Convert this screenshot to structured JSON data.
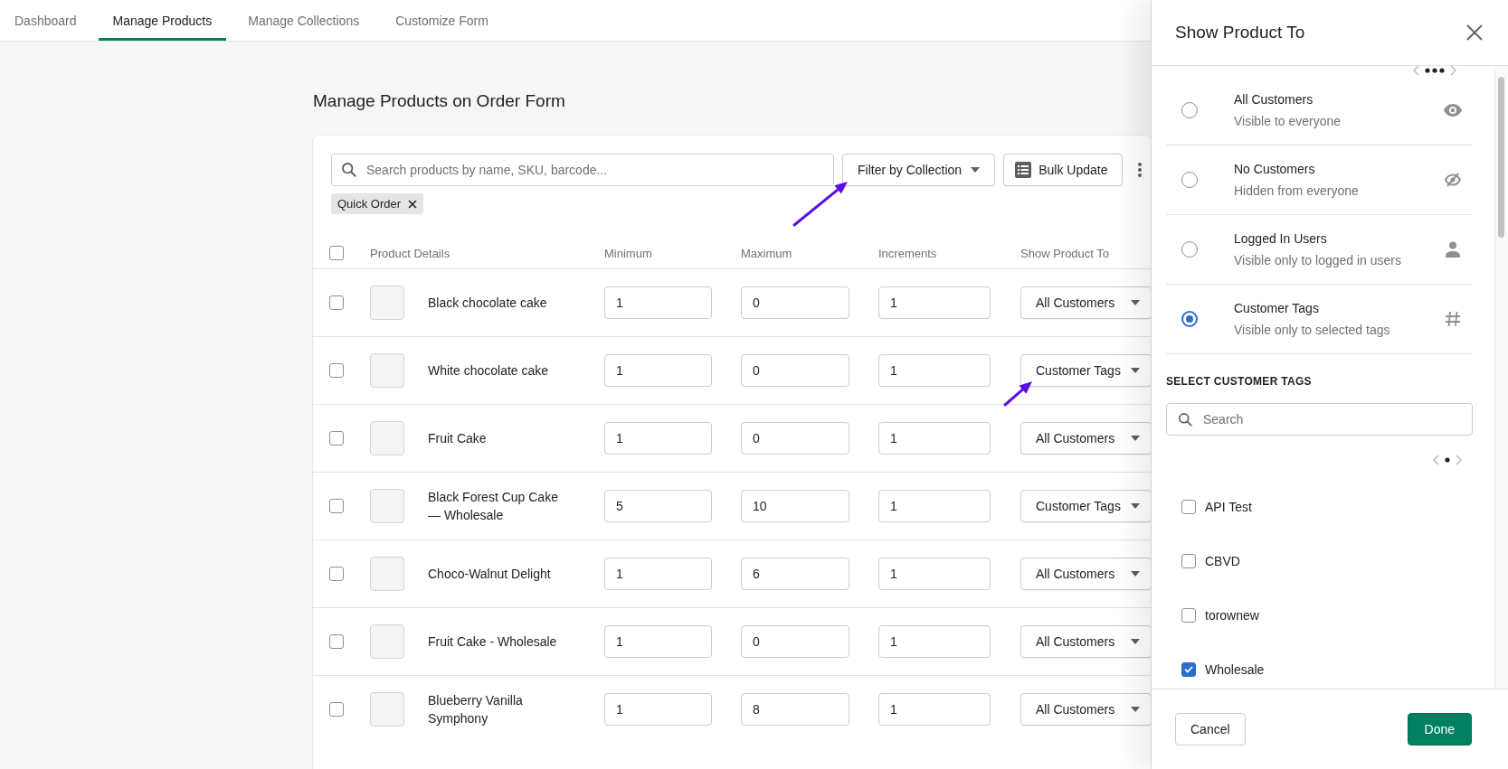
{
  "tabs": [
    {
      "label": "Dashboard",
      "selected": false
    },
    {
      "label": "Manage Products",
      "selected": true
    },
    {
      "label": "Manage Collections",
      "selected": false
    },
    {
      "label": "Customize Form",
      "selected": false
    }
  ],
  "page_title": "Manage Products on Order Form",
  "search": {
    "placeholder": "Search products by name, SKU, barcode..."
  },
  "filter_button": "Filter by Collection",
  "bulk_button": "Bulk Update",
  "filter_chips": [
    {
      "label": "Quick Order"
    }
  ],
  "table": {
    "select_all_checked": false,
    "columns": [
      "Product Details",
      "Minimum",
      "Maximum",
      "Increments",
      "Show Product To"
    ],
    "rows": [
      {
        "checked": false,
        "name": "Black chocolate cake",
        "minimum": "1",
        "maximum": "0",
        "increments": "1",
        "visibility": "All Customers"
      },
      {
        "checked": false,
        "name": "White chocolate cake",
        "minimum": "1",
        "maximum": "0",
        "increments": "1",
        "visibility": "Customer Tags"
      },
      {
        "checked": false,
        "name": "Fruit Cake",
        "minimum": "1",
        "maximum": "0",
        "increments": "1",
        "visibility": "All Customers"
      },
      {
        "checked": false,
        "name": "Black Forest Cup Cake — Wholesale",
        "minimum": "5",
        "maximum": "10",
        "increments": "1",
        "visibility": "Customer Tags"
      },
      {
        "checked": false,
        "name": "Choco-Walnut Delight",
        "minimum": "1",
        "maximum": "6",
        "increments": "1",
        "visibility": "All Customers"
      },
      {
        "checked": false,
        "name": "Fruit Cake - Wholesale",
        "minimum": "1",
        "maximum": "0",
        "increments": "1",
        "visibility": "All Customers"
      },
      {
        "checked": false,
        "name": "Blueberry Vanilla Symphony",
        "minimum": "1",
        "maximum": "8",
        "increments": "1",
        "visibility": "All Customers"
      }
    ]
  },
  "panel": {
    "title": "Show Product To",
    "options": [
      {
        "kind": "eye",
        "title": "All Customers",
        "subtitle": "Visible to everyone",
        "selected": false
      },
      {
        "kind": "eye-off",
        "title": "No Customers",
        "subtitle": "Hidden from everyone",
        "selected": false
      },
      {
        "kind": "user",
        "title": "Logged In Users",
        "subtitle": "Visible only to logged in users",
        "selected": false
      },
      {
        "kind": "hash",
        "title": "Customer Tags",
        "subtitle": "Visible only to selected tags",
        "selected": true
      }
    ],
    "tags_heading": "SELECT CUSTOMER TAGS",
    "tag_search": {
      "placeholder": "Search"
    },
    "tags": [
      {
        "label": "API Test",
        "checked": false
      },
      {
        "label": "CBVD",
        "checked": false
      },
      {
        "label": "torownew",
        "checked": false
      },
      {
        "label": "Wholesale",
        "checked": true
      }
    ],
    "cancel_button": "Cancel",
    "done_button": "Done"
  }
}
